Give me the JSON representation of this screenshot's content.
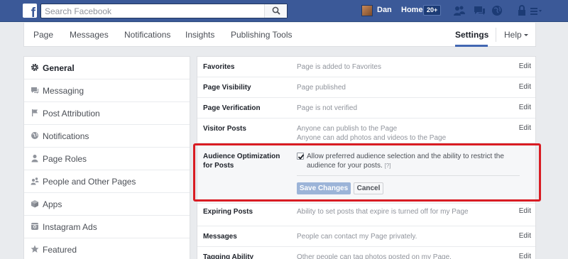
{
  "topbar": {
    "search_placeholder": "Search Facebook",
    "user_name": "Dan",
    "home_label": "Home",
    "home_count": "20+"
  },
  "pagenav": {
    "tabs": [
      "Page",
      "Messages",
      "Notifications",
      "Insights",
      "Publishing Tools"
    ],
    "settings_label": "Settings",
    "help_label": "Help"
  },
  "sidebar": {
    "items": [
      {
        "label": "General",
        "icon": "gear-icon"
      },
      {
        "label": "Messaging",
        "icon": "speech-bubble-icon"
      },
      {
        "label": "Post Attribution",
        "icon": "flag-icon"
      },
      {
        "label": "Notifications",
        "icon": "globe-icon"
      },
      {
        "label": "Page Roles",
        "icon": "person-icon"
      },
      {
        "label": "People and Other Pages",
        "icon": "people-icon"
      },
      {
        "label": "Apps",
        "icon": "cube-icon"
      },
      {
        "label": "Instagram Ads",
        "icon": "instagram-icon"
      },
      {
        "label": "Featured",
        "icon": "star-icon"
      }
    ]
  },
  "settings": {
    "favorites": {
      "label": "Favorites",
      "value": "Page is added to Favorites",
      "edit": "Edit"
    },
    "visibility": {
      "label": "Page Visibility",
      "value": "Page published",
      "edit": "Edit"
    },
    "verification": {
      "label": "Page Verification",
      "value": "Page is not verified",
      "edit": "Edit"
    },
    "visitor_posts": {
      "label": "Visitor Posts",
      "value_1": "Anyone can publish to the Page",
      "value_2": "Anyone can add photos and videos to the Page",
      "edit": "Edit"
    },
    "audience": {
      "label": "Audience Optimization for Posts",
      "checkbox_text": "Allow preferred audience selection and the ability to restrict the audience for your posts.",
      "help_marker": "[?]",
      "checked": true,
      "save_label": "Save Changes",
      "cancel_label": "Cancel"
    },
    "expiring": {
      "label": "Expiring Posts",
      "value": "Ability to set posts that expire is turned off for my Page",
      "edit": "Edit"
    },
    "messages": {
      "label": "Messages",
      "value": "People can contact my Page privately.",
      "edit": "Edit"
    },
    "tagging": {
      "label": "Tagging Ability",
      "value": "Other people can tag photos posted on my Page.",
      "edit": "Edit"
    }
  },
  "colors": {
    "brand_blue": "#3b5998",
    "highlight_red": "#d91c23"
  }
}
